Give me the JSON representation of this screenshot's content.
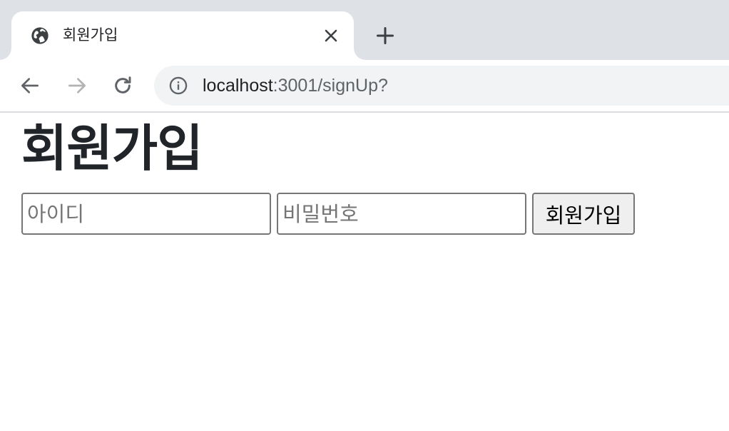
{
  "tab": {
    "title": "회원가입",
    "favicon": "globe-icon",
    "close_icon": "close-icon",
    "new_tab_icon": "plus-icon"
  },
  "toolbar": {
    "back_icon": "arrow-left-icon",
    "forward_icon": "arrow-right-icon",
    "reload_icon": "reload-icon",
    "site_info_icon": "info-icon",
    "url_host": "localhost",
    "url_rest": ":3001/signUp?"
  },
  "page": {
    "heading": "회원가입",
    "id_placeholder": "아이디",
    "password_placeholder": "비밀번호",
    "submit_label": "회원가입"
  },
  "colors": {
    "tabstrip_bg": "#dee1e6",
    "omnibox_bg": "#f1f3f4",
    "icon_dark": "#5f6368",
    "icon_disabled": "#b3b3b3",
    "button_bg": "#efefef",
    "input_border": "#767676"
  }
}
